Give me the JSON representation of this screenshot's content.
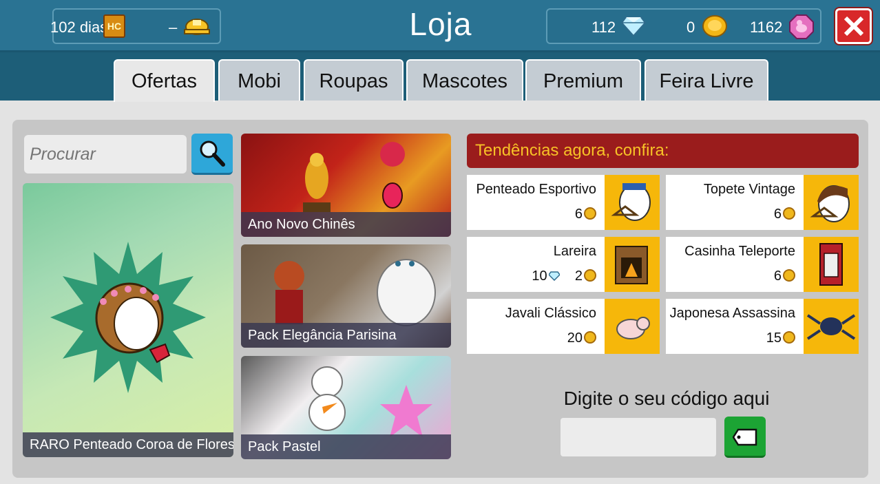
{
  "header": {
    "title": "Loja",
    "club_days": "102 dias",
    "builders_club": "–",
    "diamonds": "112",
    "credits": "0",
    "duckets": "1162"
  },
  "tabs": [
    {
      "label": "Ofertas",
      "active": true
    },
    {
      "label": "Mobi",
      "active": false
    },
    {
      "label": "Roupas",
      "active": false
    },
    {
      "label": "Mascotes",
      "active": false
    },
    {
      "label": "Premium",
      "active": false
    },
    {
      "label": "Feira Livre",
      "active": false
    }
  ],
  "search": {
    "placeholder": "Procurar"
  },
  "featured": {
    "label": "RARO Penteado Coroa de Flores"
  },
  "promos": [
    {
      "label": "Ano Novo Chinês"
    },
    {
      "label": "Pack Elegância Parisina"
    },
    {
      "label": "Pack Pastel"
    }
  ],
  "trending": {
    "header": "Tendências agora, confira:",
    "items": [
      {
        "name": "Penteado Esportivo",
        "price_coins": "6",
        "icon": "hair-icon"
      },
      {
        "name": "Topete Vintage",
        "price_coins": "6",
        "icon": "hair-icon"
      },
      {
        "name": "Lareira",
        "price_diamonds": "10",
        "price_coins": "2",
        "icon": "fireplace-icon"
      },
      {
        "name": "Casinha Teleporte",
        "price_coins": "6",
        "icon": "teleport-booth-icon"
      },
      {
        "name": "Javali Clássico",
        "price_coins": "20",
        "icon": "pig-icon"
      },
      {
        "name": "Japonesa Assassina",
        "price_coins": "15",
        "icon": "spider-icon"
      }
    ]
  },
  "code": {
    "label": "Digite o seu código aqui"
  },
  "colors": {
    "header_bg": "#2a7393",
    "tab_bar_bg": "#1d5e78",
    "trend_header_bg": "#9a1c1c",
    "trend_header_text": "#f7c227",
    "thumb_bg": "#f6b70a",
    "search_button": "#2ea7d9",
    "code_button": "#1ca434",
    "close_button": "#d8282a"
  }
}
